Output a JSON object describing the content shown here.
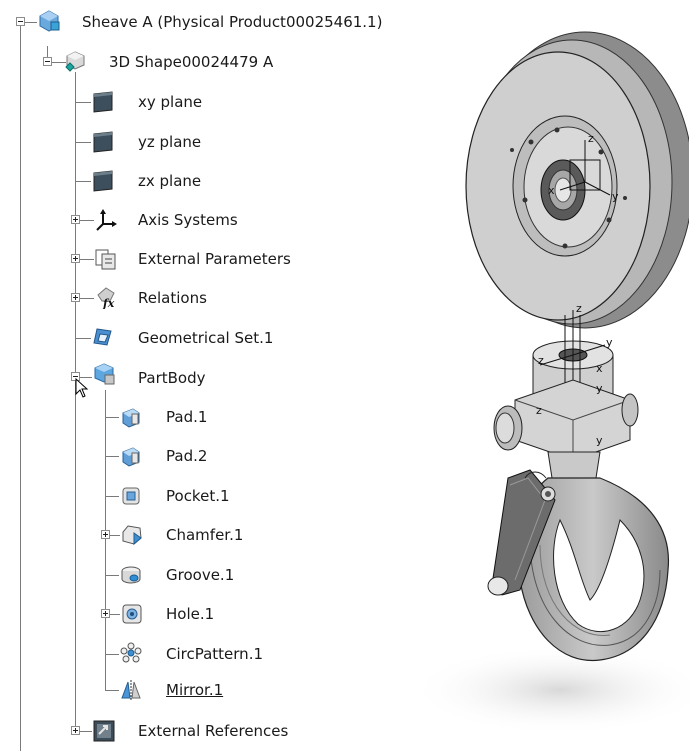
{
  "tree": {
    "root": {
      "label": "Sheave A (Physical Product00025461.1)",
      "icon": "product-icon"
    },
    "shape": {
      "label": "3D Shape00024479 A",
      "icon": "3d-shape-icon"
    },
    "items": [
      {
        "label": "xy plane",
        "icon": "plane-icon"
      },
      {
        "label": "yz plane",
        "icon": "plane-icon"
      },
      {
        "label": "zx plane",
        "icon": "plane-icon"
      },
      {
        "label": "Axis Systems",
        "icon": "axis-system-icon"
      },
      {
        "label": "External Parameters",
        "icon": "parameters-icon"
      },
      {
        "label": "Relations",
        "icon": "relations-icon"
      },
      {
        "label": "Geometrical Set.1",
        "icon": "geometrical-set-icon"
      },
      {
        "label": "PartBody",
        "icon": "partbody-icon"
      },
      {
        "label": "External References",
        "icon": "external-references-icon"
      }
    ],
    "partbody": [
      {
        "label": "Pad.1",
        "icon": "pad-icon"
      },
      {
        "label": "Pad.2",
        "icon": "pad-icon"
      },
      {
        "label": "Pocket.1",
        "icon": "pocket-icon"
      },
      {
        "label": "Chamfer.1",
        "icon": "chamfer-icon"
      },
      {
        "label": "Groove.1",
        "icon": "groove-icon"
      },
      {
        "label": "Hole.1",
        "icon": "hole-icon"
      },
      {
        "label": "CircPattern.1",
        "icon": "circ-pattern-icon"
      },
      {
        "label": "Mirror.1",
        "icon": "mirror-icon"
      }
    ]
  },
  "viewport": {
    "axis_labels": [
      "z",
      "x",
      "y",
      "z",
      "y",
      "z",
      "x",
      "y",
      "z",
      "y"
    ],
    "model": "sheave-and-hook-3d-model"
  }
}
